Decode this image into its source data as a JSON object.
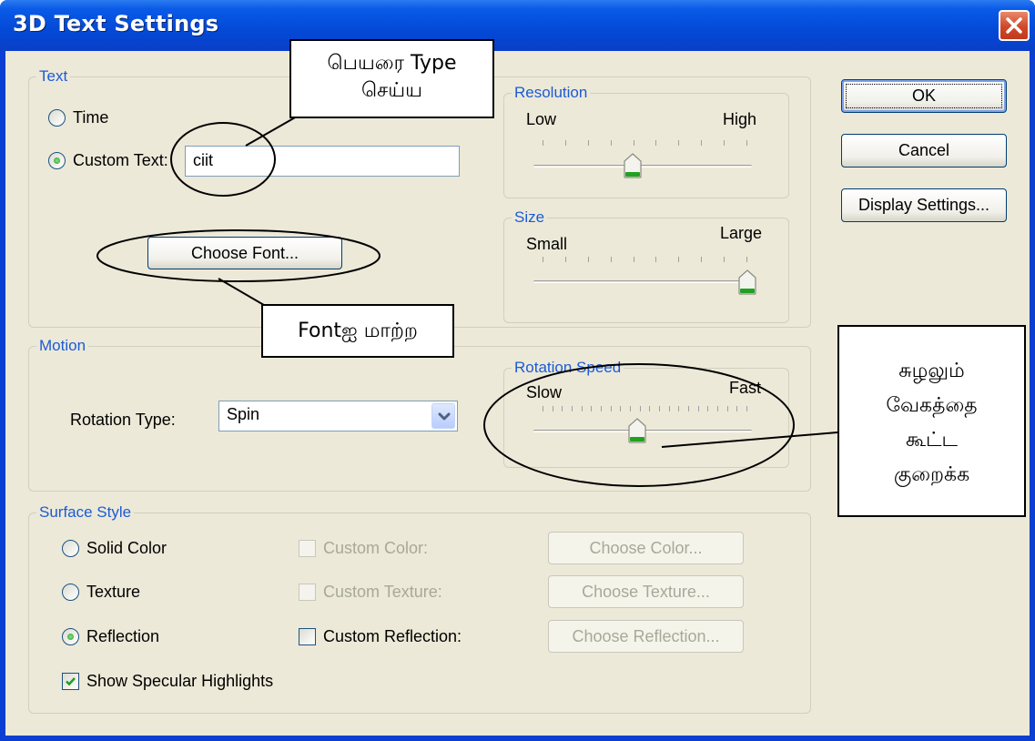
{
  "window": {
    "title": "3D Text Settings"
  },
  "text_group": {
    "label": "Text",
    "time_label": "Time",
    "custom_text_label": "Custom Text:",
    "custom_text_value": "ciit",
    "choose_font": "Choose Font..."
  },
  "resolution": {
    "label": "Resolution",
    "low": "Low",
    "high": "High",
    "level": 0.44
  },
  "size": {
    "label": "Size",
    "small": "Small",
    "large": "Large",
    "level": 1.0
  },
  "motion_group": {
    "label": "Motion",
    "rotation_type_label": "Rotation Type:",
    "rotation_type_value": "Spin"
  },
  "rotation_speed": {
    "label": "Rotation Speed",
    "slow": "Slow",
    "fast": "Fast",
    "level": 0.46
  },
  "surface_group": {
    "label": "Surface Style",
    "solid_color": "Solid Color",
    "texture": "Texture",
    "reflection": "Reflection",
    "custom_color": "Custom Color:",
    "custom_texture": "Custom Texture:",
    "custom_reflection": "Custom Reflection:",
    "choose_color": "Choose Color...",
    "choose_texture": "Choose Texture...",
    "choose_reflection": "Choose Reflection...",
    "show_specular": "Show Specular Highlights"
  },
  "buttons": {
    "ok": "OK",
    "cancel": "Cancel",
    "display_settings": "Display Settings..."
  },
  "annotations": {
    "type_name_line1": "பெயரை Type",
    "type_name_line2": "செய்ய",
    "change_font": "Fontஐ மாற்ற",
    "speed_line1": "சுழலும்",
    "speed_line2": "வேகத்தை",
    "speed_line3": "கூட்ட",
    "speed_line4": "குறைக்க"
  },
  "colors": {
    "titlebar": "#0a5ae8",
    "group_label": "#1c5bd6",
    "dialog_bg": "#ece9d8",
    "close": "#d0482a",
    "thumb_accent": "#21a121"
  },
  "icons": {
    "close": "close-icon",
    "dropdown": "chevron-down-icon",
    "check": "checkmark-icon"
  }
}
